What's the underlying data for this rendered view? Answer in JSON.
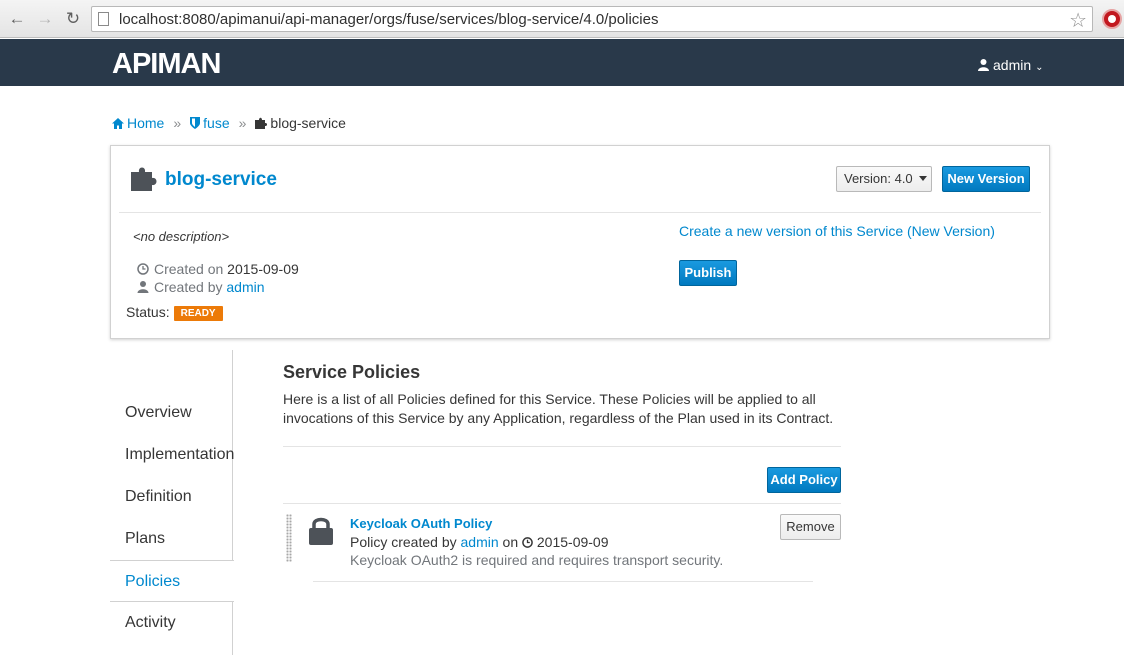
{
  "browser": {
    "url": "localhost:8080/apimanui/api-manager/orgs/fuse/services/blog-service/4.0/policies"
  },
  "header": {
    "logo": "APIMAN",
    "user": "admin"
  },
  "breadcrumb": {
    "home": "Home",
    "org": "fuse",
    "service": "blog-service"
  },
  "service": {
    "name": "blog-service",
    "version_label": "Version: 4.0",
    "new_version_label": "New Version",
    "description": "<no description>",
    "created_on_label": "Created on",
    "created_on": "2015-09-09",
    "created_by_label": "Created by",
    "created_by": "admin",
    "status_label": "Status:",
    "status": "READY",
    "status_color": "#ec7a08",
    "new_version_link": "Create a new version of this Service (New Version)",
    "publish_label": "Publish"
  },
  "sidebar": {
    "items": [
      {
        "label": "Overview",
        "active": false
      },
      {
        "label": "Implementation",
        "active": false
      },
      {
        "label": "Definition",
        "active": false
      },
      {
        "label": "Plans",
        "active": false
      },
      {
        "label": "Policies",
        "active": true
      },
      {
        "label": "Activity",
        "active": false
      }
    ]
  },
  "policies": {
    "title": "Service Policies",
    "description": "Here is a list of all Policies defined for this Service. These Policies will be applied to all invocations of this Service by any Application, regardless of the Plan used in its Contract.",
    "add_label": "Add Policy",
    "items": [
      {
        "name": "Keycloak OAuth Policy",
        "created_prefix": "Policy created by",
        "created_by": "admin",
        "on_label": "on",
        "date": "2015-09-09",
        "description": "Keycloak OAuth2 is required and requires transport security.",
        "remove_label": "Remove",
        "icon": "lock-icon"
      }
    ]
  },
  "colors": {
    "header_bg": "#29394a",
    "link": "#0088ce",
    "primary_button": "#0088ce"
  }
}
